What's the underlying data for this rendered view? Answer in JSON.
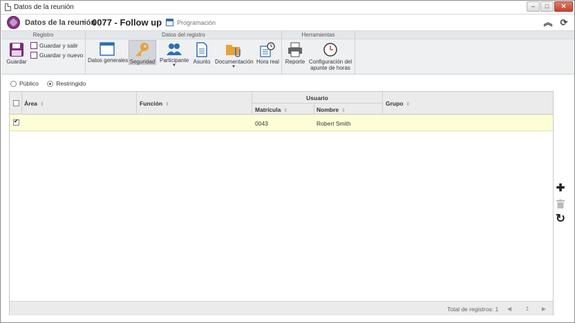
{
  "window": {
    "title": "Datos de la reunión",
    "controls": {
      "minimize": "–",
      "maximize": "□",
      "close": "✕"
    }
  },
  "header": {
    "breadcrumb_root": "Datos de la reunión",
    "breadcrumb_separator": "›",
    "record_title": "0077 - Follow up",
    "programacion_label": "Programación",
    "collapse_icon": "double-chevron-up-icon",
    "refresh_icon": "refresh-icon"
  },
  "ribbon": {
    "groups": [
      {
        "title": "Registro"
      },
      {
        "title": "Datos del registro"
      },
      {
        "title": "Herramientas"
      }
    ],
    "registro": {
      "save_label": "Guardar",
      "save_exit_label": "Guardar y salir",
      "save_new_label": "Guardar y nuevo"
    },
    "datos": {
      "general_label": "Datos generales",
      "security_label": "Seguridad",
      "participant_label": "Participante",
      "subject_label": "Asunto",
      "documentation_label": "Documentación",
      "real_time_label": "Hora real"
    },
    "herramientas": {
      "report_label": "Reporte",
      "config_label_line1": "Configuración del",
      "config_label_line2": "apunte de horas"
    }
  },
  "access": {
    "options": [
      {
        "label": "Público",
        "checked": false
      },
      {
        "label": "Restringido",
        "checked": true
      }
    ]
  },
  "grid": {
    "columns": {
      "area": "Área",
      "funcion": "Función",
      "usuario": "Usuario",
      "matricula": "Matrícula",
      "nombre": "Nombre",
      "grupo": "Grupo"
    },
    "rows": [
      {
        "checked": true,
        "area": "",
        "funcion": "",
        "matricula": "0043",
        "nombre": "Robert Smith",
        "grupo": ""
      }
    ],
    "footer": {
      "total_label": "Total de registros: 1",
      "page": "1",
      "prev": "◀",
      "next": "▶"
    }
  },
  "side_tools": {
    "add_icon": "plus-icon",
    "delete_icon": "trash-icon",
    "reload_icon": "refresh-icon"
  }
}
